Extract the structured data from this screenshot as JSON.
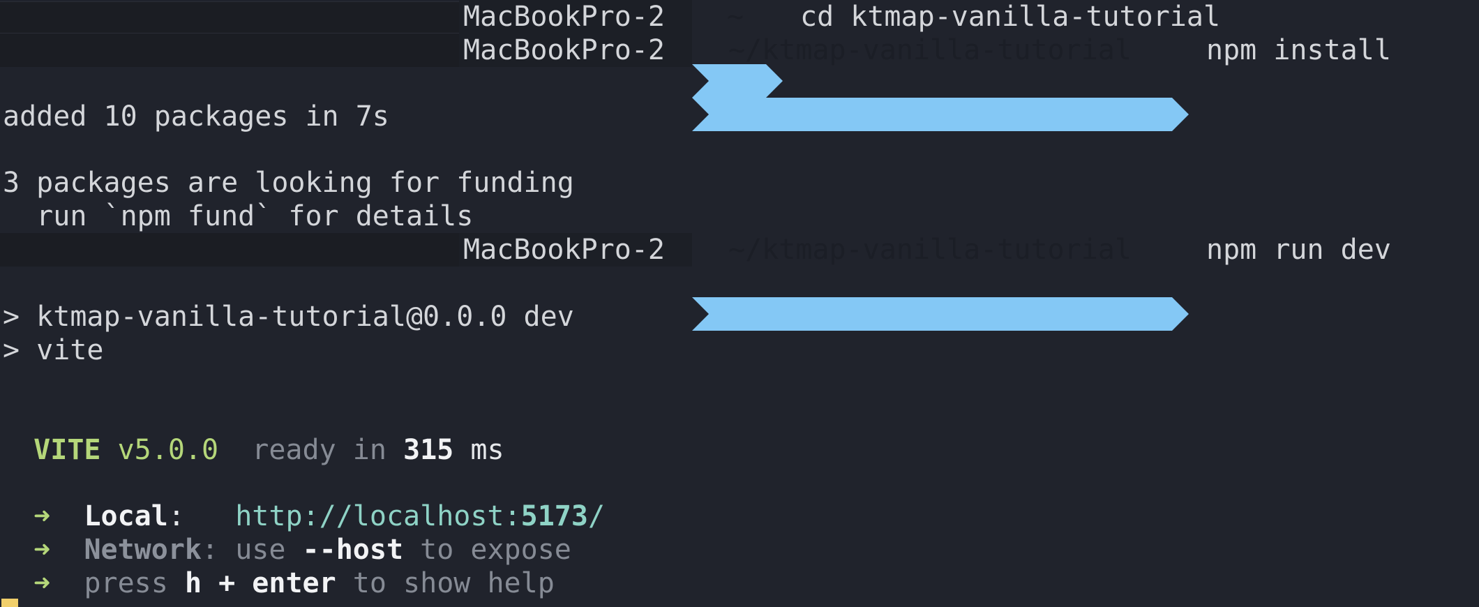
{
  "colors": {
    "background": "#20232c",
    "prompt_path_bg": "#84c8f5",
    "vite_green": "#b5d77a",
    "url_cyan": "#8fd3c6",
    "cursor": "#f1cf6b"
  },
  "prompt1": {
    "host": "MacBookPro-2",
    "path": "~",
    "command": "cd ktmap-vanilla-tutorial"
  },
  "prompt2": {
    "host": "MacBookPro-2",
    "path": "~/ktmap-vanilla-tutorial",
    "command": "npm install"
  },
  "out_added": "added 10 packages in 7s",
  "out_funding1": "3 packages are looking for funding",
  "out_funding2": "  run `npm fund` for details",
  "prompt3": {
    "host": "MacBookPro-2",
    "path": "~/ktmap-vanilla-tutorial",
    "command": "npm run dev"
  },
  "script_line1": "> ktmap-vanilla-tutorial@0.0.0 dev",
  "script_line2": "> vite",
  "vite": {
    "name": "VITE",
    "version": "v5.0.0",
    "ready_prefix": "ready in",
    "ready_ms": "315",
    "ready_unit": "ms"
  },
  "local": {
    "arrow": "➜",
    "label": "Local",
    "colon": ":",
    "url_prefix": "http://localhost:",
    "port": "5173",
    "url_suffix": "/"
  },
  "network": {
    "arrow": "➜",
    "label": "Network",
    "colon": ":",
    "use": "use",
    "flag": "--host",
    "rest": "to expose"
  },
  "help": {
    "arrow": "➜",
    "press": "press",
    "keys": "h + enter",
    "rest": "to show help"
  }
}
